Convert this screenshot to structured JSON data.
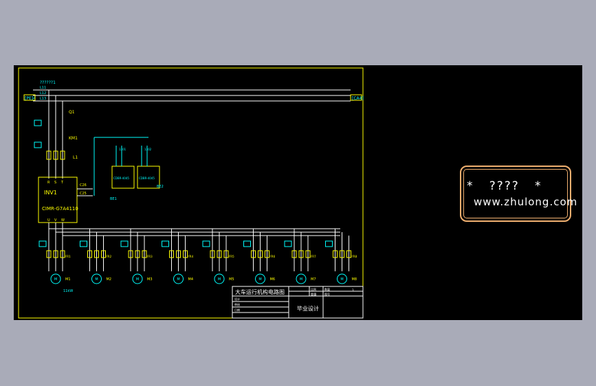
{
  "diagram": {
    "supply_label": "??????1",
    "phase_labels": [
      "L11",
      "L12",
      "L13"
    ],
    "left_tag": "[PE]4",
    "right_tag": "[CA4]",
    "breaker_label": "Q1",
    "contactor_label": "KM1",
    "reactor_label": "L1",
    "inverter_title": "INV1",
    "inverter_model": "CIMR-G7A4110",
    "inverter_inputs": [
      "R",
      "S",
      "T"
    ],
    "inverter_outputs": [
      "U",
      "V",
      "W"
    ],
    "signal_labels": [
      "C26",
      "C25"
    ],
    "brake_units": [
      "CDBR-4045",
      "CDBR-4045"
    ],
    "brake_tags": [
      "BE1",
      "BE2"
    ],
    "brake_resistors": [
      "1301",
      "1302"
    ],
    "motors": [
      {
        "id": "M1",
        "relay": "FR1"
      },
      {
        "id": "M2",
        "relay": "FR2"
      },
      {
        "id": "M3",
        "relay": "FR3"
      },
      {
        "id": "M4",
        "relay": "FR4"
      },
      {
        "id": "M5",
        "relay": "FR5"
      },
      {
        "id": "M6",
        "relay": "FR6"
      },
      {
        "id": "M7",
        "relay": "FR7"
      },
      {
        "id": "M8",
        "relay": "FR8"
      }
    ],
    "motor_note": "11kW"
  },
  "title_block": {
    "drawing_title": "大车运行机构电路图",
    "project": "毕业设计",
    "fields": [
      "比例",
      "重量",
      "数量",
      "1",
      "图号",
      "3",
      "设计",
      "审核",
      "日期"
    ]
  },
  "watermark": {
    "line1": "*   ????   *",
    "line2": "www.zhulong.com"
  },
  "colors": {
    "background": "#000000",
    "frame": "#ffff00",
    "wires": "#ffffff",
    "components": "#00ffff",
    "motor": "#00ffff",
    "watermark_border": "#f0b070",
    "page_gray": "#a9abb8"
  }
}
